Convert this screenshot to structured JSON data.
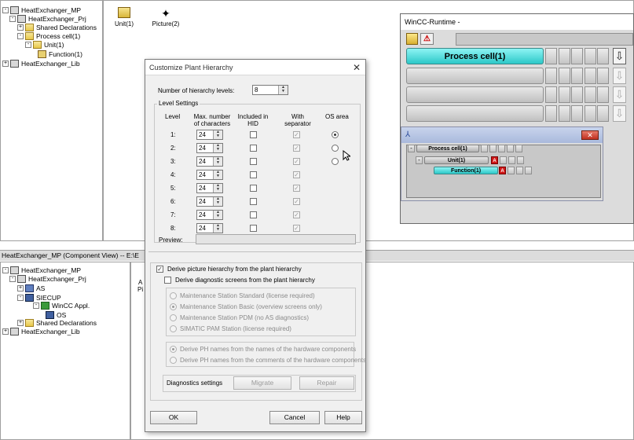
{
  "top_tree": [
    {
      "label": "HeatExchanger_MP",
      "icon": "project-icon",
      "expander": "-"
    },
    {
      "label": "HeatExchanger_Prj",
      "icon": "project-icon",
      "expander": "-"
    },
    {
      "label": "Shared Declarations",
      "icon": "folder-icon",
      "expander": "+"
    },
    {
      "label": "Process cell(1)",
      "icon": "folder-icon",
      "expander": "-"
    },
    {
      "label": "Unit(1)",
      "icon": "folder-icon",
      "expander": "-"
    },
    {
      "label": "Function(1)",
      "icon": "function-icon",
      "expander": ""
    },
    {
      "label": "HeatExchanger_Lib",
      "icon": "project-icon",
      "expander": "+"
    }
  ],
  "top_right_items": [
    {
      "label": "Unit(1)",
      "icon": "folder-icon"
    },
    {
      "label": "Picture(2)",
      "icon": "picture-icon"
    }
  ],
  "bottom_title": "HeatExchanger_MP (Component View) -- E:\\E",
  "bottom_tree": [
    {
      "label": "HeatExchanger_MP",
      "icon": "project-icon",
      "expander": "-"
    },
    {
      "label": "HeatExchanger_Prj",
      "icon": "project-icon",
      "expander": "-"
    },
    {
      "label": "AS",
      "icon": "network-icon",
      "expander": "+"
    },
    {
      "label": "SIECUP",
      "icon": "computer-icon",
      "expander": "-"
    },
    {
      "label": "WinCC Appl.",
      "icon": "wincc-icon",
      "expander": "-"
    },
    {
      "label": "OS",
      "icon": "os-icon",
      "expander": ""
    },
    {
      "label": "Shared Declarations",
      "icon": "folder-icon",
      "expander": "+"
    },
    {
      "label": "HeatExchanger_Lib",
      "icon": "project-icon",
      "expander": "+"
    }
  ],
  "bottom_right_fragment": {
    "a": "A",
    "pi": "Pi"
  },
  "dialog": {
    "title": "Customize Plant Hierarchy",
    "num_levels_label": "Number of hierarchy levels:",
    "num_levels_value": "8",
    "level_settings_label": "Level Settings",
    "col_level": "Level",
    "col_max_chars": "Max. number of characters",
    "col_hid": "Included in HID",
    "col_separator": "With separator",
    "col_os_area": "OS area",
    "levels": [
      {
        "level": "1:",
        "chars": "24",
        "hid": false,
        "separator": true,
        "os_area": "selected"
      },
      {
        "level": "2:",
        "chars": "24",
        "hid": false,
        "separator": true,
        "os_area": "unselected"
      },
      {
        "level": "3:",
        "chars": "24",
        "hid": false,
        "separator": true,
        "os_area": "unselected"
      },
      {
        "level": "4:",
        "chars": "24",
        "hid": false,
        "separator": true,
        "os_area": ""
      },
      {
        "level": "5:",
        "chars": "24",
        "hid": false,
        "separator": true,
        "os_area": ""
      },
      {
        "level": "6:",
        "chars": "24",
        "hid": false,
        "separator": true,
        "os_area": ""
      },
      {
        "level": "7:",
        "chars": "24",
        "hid": false,
        "separator": true,
        "os_area": ""
      },
      {
        "level": "8:",
        "chars": "24",
        "hid": false,
        "separator": true,
        "os_area": ""
      }
    ],
    "preview_label": "Preview:",
    "preview_value": "",
    "derive_picture_label": "Derive picture hierarchy from the plant hierarchy",
    "derive_picture_checked": true,
    "derive_diag_label": "Derive diagnostic screens from the plant hierarchy",
    "derive_diag_checked": false,
    "station_options": [
      {
        "label": "Maintenance Station Standard (license required)",
        "selected": false
      },
      {
        "label": "Maintenance Station Basic (overview screens only)",
        "selected": true
      },
      {
        "label": "Maintenance Station PDM (no AS diagnostics)",
        "selected": false
      },
      {
        "label": "SIMATIC PAM Station (license required)",
        "selected": false
      }
    ],
    "ph_options": [
      {
        "label": "Derive PH names from the names of the hardware components",
        "selected": true
      },
      {
        "label": "Derive PH names from the comments of the hardware components",
        "selected": false
      }
    ],
    "diag_settings_label": "Diagnostics settings",
    "migrate_label": "Migrate",
    "repair_label": "Repair",
    "ok_label": "OK",
    "cancel_label": "Cancel",
    "help_label": "Help"
  },
  "runtime": {
    "title": "WinCC-Runtime -",
    "active_bar_label": "Process cell(1)",
    "accent_color": "#2cc8c8",
    "sub_rows": [
      {
        "label": "Process cell(1)",
        "expander": "-",
        "alarm": false
      },
      {
        "label": "Unit(1)",
        "expander": "-",
        "alarm": true
      },
      {
        "label": "Function(1)",
        "expander": "",
        "alarm": true
      }
    ],
    "alarm_letter": "A",
    "alarm_color": "#d01818"
  }
}
